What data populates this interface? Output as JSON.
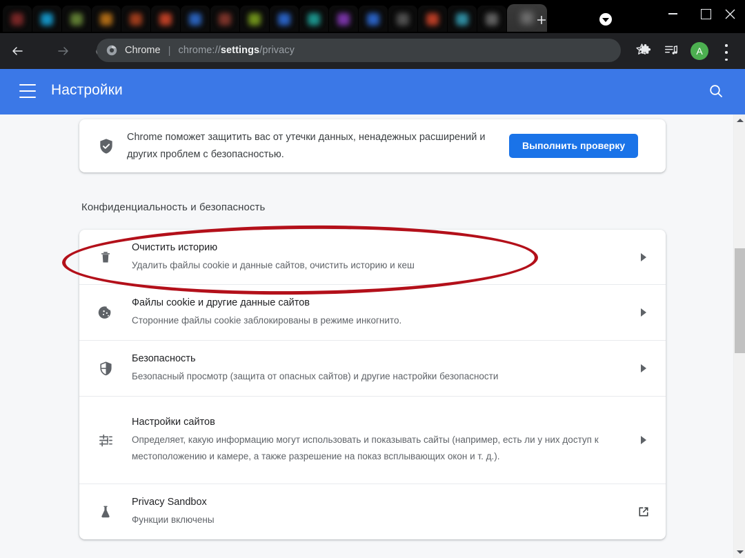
{
  "window": {
    "new_tab_label": "+",
    "minimize_label": "minimize",
    "maximize_label": "maximize",
    "close_label": "close",
    "tab_count": 17,
    "tab_colors": [
      "#8a2b2b",
      "#16a7e0",
      "#6d8f3a",
      "#c87a18",
      "#b5441f",
      "#d8482a",
      "#2f6fd6",
      "#8e3a2f",
      "#7fa61e",
      "#2e6fe0",
      "#1fa8a0",
      "#8a3bbf",
      "#2f6fe0",
      "#5a5a5a",
      "#d4452a",
      "#35a0b8",
      "#6d6d6d"
    ]
  },
  "toolbar": {
    "brand_chip": "Chrome",
    "separator": "|",
    "url_prefix": "chrome://",
    "url_bold": "settings",
    "url_suffix": "/privacy",
    "bookmark_icon": "star-icon",
    "extensions_icon": "puzzle-icon",
    "media_icon": "media-playlist-icon",
    "avatar_letter": "A",
    "menu_icon": "kebab-menu-icon"
  },
  "settings_header": {
    "menu_icon": "hamburger-icon",
    "title": "Настройки",
    "search_icon": "search-icon"
  },
  "safety_check": {
    "icon": "shield-check-icon",
    "text": "Chrome поможет защитить вас от утечки данных, ненадежных расширений и других проблем с безопасностью.",
    "button_label": "Выполнить проверку",
    "button_color": "#1a73e8"
  },
  "section": {
    "heading": "Конфиденциальность и безопасность"
  },
  "privacy_rows": [
    {
      "id": "clear-browsing-data",
      "icon": "trash-icon",
      "title": "Очистить историю",
      "subtitle": "Удалить файлы cookie и данные сайтов, очистить историю и кеш",
      "end_icon": "chevron-right-icon"
    },
    {
      "id": "cookies",
      "icon": "cookie-icon",
      "title": "Файлы cookie и другие данные сайтов",
      "subtitle": "Сторонние файлы cookie заблокированы в режиме инкогнито.",
      "end_icon": "chevron-right-icon"
    },
    {
      "id": "security",
      "icon": "shield-icon",
      "title": "Безопасность",
      "subtitle": "Безопасный просмотр (защита от опасных сайтов) и другие настройки безопасности",
      "end_icon": "chevron-right-icon"
    },
    {
      "id": "site-settings",
      "icon": "tune-sliders-icon",
      "title": "Настройки сайтов",
      "subtitle": "Определяет, какую информацию могут использовать и показывать сайты (например, есть ли у них доступ к местоположению и камере, а также разрешение на показ всплывающих окон и т. д.).",
      "end_icon": "chevron-right-icon"
    },
    {
      "id": "privacy-sandbox",
      "icon": "flask-icon",
      "title": "Privacy Sandbox",
      "subtitle": "Функции включены",
      "end_icon": "open-in-new-icon"
    }
  ],
  "annotation": {
    "shape": "ellipse",
    "color": "#b3101a",
    "targets_row": "clear-browsing-data"
  },
  "scrollbar": {
    "up_icon": "scroll-up-arrow",
    "down_icon": "scroll-down-arrow",
    "thumb_color": "#c1c1c1"
  }
}
